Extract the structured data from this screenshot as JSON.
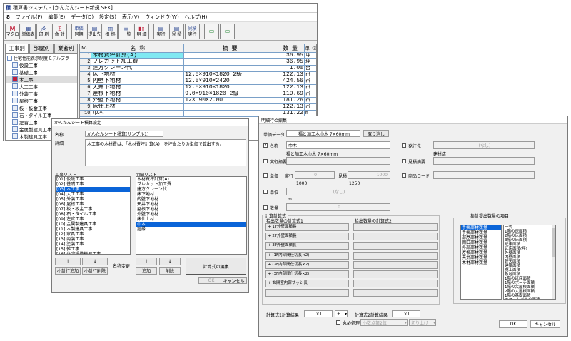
{
  "main": {
    "title": "積算書システム - [かんたんシート新規.SEK]",
    "menu": [
      "ファイル(F)",
      "編集(E)",
      "データ(D)",
      "設定(S)",
      "表示(V)",
      "ウィンドウ(W)",
      "ヘルプ(H)"
    ],
    "toolbar": [
      {
        "icon": "M",
        "label": "マクロ"
      },
      {
        "icon": "▦",
        "label": "単価表"
      },
      {
        "icon": "⎙",
        "label": "印 刷"
      },
      {
        "icon": "Σ",
        "label": "合 計"
      },
      {
        "icon": "単価",
        "label": "同期"
      },
      {
        "icon": "▤",
        "label": "提出先"
      },
      {
        "icon": "▥",
        "label": "根 拠"
      },
      {
        "icon": "≡",
        "label": "一 覧"
      },
      {
        "icon": "▮▯",
        "label": "明 細"
      },
      {
        "icon": "▤",
        "label": "実行"
      },
      {
        "icon": "▤",
        "label": "見 積"
      },
      {
        "icon": "見積",
        "label": "実行"
      },
      {
        "icon": "▭",
        "label": ""
      },
      {
        "icon": "▭",
        "label": ""
      }
    ],
    "side_tabs": [
      "工事別",
      "部屋別",
      "業者別"
    ],
    "tree_root": "住宅性能表示制度モデルプラ",
    "tree": [
      "仮設工事",
      "基礎工事",
      "木工事",
      "大工工事",
      "外装工事",
      "屋根工事",
      "板・板金工事",
      "石・タイル工事",
      "左官工事",
      "金属製建具工事",
      "木製建具工事",
      "家具工事"
    ],
    "grid_headers": [
      "No.",
      "名 称",
      "摘 要",
      "数 量",
      "単 位"
    ],
    "rows": [
      {
        "no": "1",
        "name": "木材費坪計算(A)",
        "note": "",
        "qty": "36.95",
        "unit": "坪"
      },
      {
        "no": "2",
        "name": "プレカット加工費",
        "note": "",
        "qty": "36.95",
        "unit": "坪"
      },
      {
        "no": "3",
        "name": "建方クレーン代",
        "note": "",
        "qty": "1.00",
        "unit": "台"
      },
      {
        "no": "4",
        "name": "床下地材",
        "note": "12.0×910×1820 2級",
        "qty": "122.13",
        "unit": "㎡"
      },
      {
        "no": "5",
        "name": "内壁下地材",
        "note": "12.5×910×2420",
        "qty": "424.56",
        "unit": "㎡"
      },
      {
        "no": "6",
        "name": "天井下地材",
        "note": "12.5×910×1820",
        "qty": "122.13",
        "unit": "㎡"
      },
      {
        "no": "7",
        "name": "屋根下地材",
        "note": "9.0×910×1820 2級",
        "qty": "119.69",
        "unit": "㎡"
      },
      {
        "no": "8",
        "name": "外壁下地材",
        "note": "12× 90×2.00",
        "qty": "181.26",
        "unit": "㎡"
      },
      {
        "no": "9",
        "name": "床仕上材",
        "note": "",
        "qty": "122.13",
        "unit": "㎡"
      },
      {
        "no": "10",
        "name": "巾木",
        "note": "",
        "qty": "131.22",
        "unit": "m"
      }
    ]
  },
  "sheet_dialog": {
    "title": "かんたんシート積算設定",
    "name_label": "名称",
    "name_value": "かんたんシート積算(サンプル1)",
    "detail_label": "詳細",
    "detail_value": "木工事の木材費は、「木材費坪計算(A)」を坪当たりの単価で算出する。",
    "work_list_label": "工事リスト",
    "work_list": [
      "[01] 仮設工事",
      "[02] 基礎工事",
      "[03] 木工事",
      "[04] 大工工事",
      "[05] 外装工事",
      "[06] 屋根工事",
      "[07] 板・板金工事",
      "[08] 石・タイル工事",
      "[09] 左官工事",
      "[10] 金属製建具工事",
      "[11] 木製建具工事",
      "[12] 家具工事",
      "[13] 内装工事",
      "[14] 塗装工事",
      "[15] 雑工事",
      "[16] 住宅設備機器工事",
      "[17] 電気設備工事",
      "[18] 給排水衛生工事",
      "[19] 冷暖房・空調設備工事"
    ],
    "work_selected": 2,
    "detail_list_label": "明細リスト",
    "detail_list": [
      "木材費坪計算(A)",
      "プレカット加工費",
      "建方クレーン代",
      "床下地材",
      "内壁下地材",
      "天井下地材",
      "屋根下地材",
      "外壁下地材",
      "床仕上材",
      "巾木",
      "廻縁"
    ],
    "detail_selected": 9,
    "buttons": {
      "add_up": "↑",
      "add_down": "↓",
      "sub_add": "小計行追加",
      "sub_del": "小計行削除",
      "rename": "名称変更",
      "up": "↑",
      "down": "↓",
      "add": "追加",
      "delete": "削除",
      "calc_edit": "計算式の編集",
      "ok": "OK",
      "cancel": "キャンセル"
    }
  },
  "detail_dialog": {
    "title": "明細行の編集",
    "price_label": "単価データ",
    "price_value": "福と加工木巾木 7×60mm",
    "price_cancel": "取り消し",
    "name_label": "名称",
    "name_value": "巾木",
    "name_sub": "福と加工木巾木 7×60mm",
    "orderer_label": "発注先",
    "orderer_value": "(なし)",
    "orderer_sub": "建材店",
    "exec_label": "実行摘要",
    "est_label": "見積摘要",
    "code_label": "商品コード",
    "unitprice_label": "単価",
    "exec_price_label": "実行",
    "exec_price": "0",
    "est_price_label": "見積",
    "est_price": "1000",
    "exec_price_sub": "1000",
    "est_price_sub": "1250",
    "unit_label": "単位",
    "unit_value": "(なし)",
    "unit_sub": "m",
    "qty_label": "数量",
    "qty_value": "0",
    "formula_group": "計算計算式",
    "formula1_label": "拾出数量の計算式1",
    "formula1": [
      "+ 1F外壁面積長",
      "+ 2F外壁面積長",
      "+ 3F外壁面積長",
      "+ (1F内部間仕切長×2)",
      "+ (2F内部間仕切長×2)",
      "+ (3F内部間仕切長×2)",
      "+ 玄関室内部サッシ長"
    ],
    "formula2_label": "拾出数量の計算式2",
    "agg_label": "集計提出数量の項目",
    "agg_left": [
      "手摺部材数量",
      "手摺部材数量",
      "部屋部材数量",
      "開口部材数量",
      "外部部材数量",
      "屋根部材数量",
      "天井部材数量",
      "木材部材数量"
    ],
    "agg_left_selected": 0,
    "agg_right": [
      "一式",
      "1階の床面積",
      "2階の床面積",
      "3階の床面積",
      "延床面積",
      "延床面積(坪)",
      "外壁面積",
      "内壁面積",
      "軒天面積",
      "建築面積",
      "施工面積",
      "敷地面積",
      "1階の延床面積",
      "1階のポーチ面積",
      "1階の大屋根面積",
      "2階の大屋根面積",
      "1階の基礎面積",
      "エコットバルの面積",
      "ベランダの面積",
      "地下面積"
    ],
    "result1_label": "計算式1計算結果",
    "result1": "×1",
    "op": "+",
    "result2_label": "計算式2計算結果",
    "result2": "×1",
    "round_label": "丸め処理",
    "round_value": "小数点第2位",
    "round_mode": "切り上げ",
    "ok": "OK",
    "cancel": "キャンセル"
  }
}
